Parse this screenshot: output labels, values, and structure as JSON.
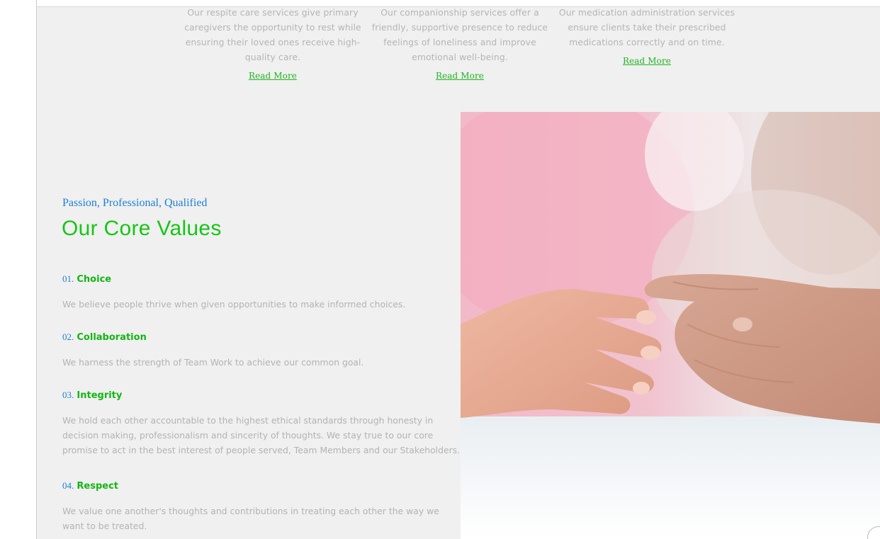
{
  "services": [
    {
      "description": "Our respite care services give primary caregivers the opportunity to rest while ensuring their loved ones receive high-quality care.",
      "lines": [
        "Our respite care services give primary",
        "caregivers the opportunity to rest while",
        "ensuring their loved ones receive high-",
        "quality care."
      ],
      "link_label": "Read More"
    },
    {
      "description": "Our companionship services offer a friendly, supportive presence to reduce feelings of loneliness and improve emotional well-being.",
      "lines": [
        "Our companionship services offer a",
        "friendly, supportive presence to reduce",
        "feelings of loneliness and improve",
        "emotional well-being."
      ],
      "link_label": "Read More"
    },
    {
      "description": "Our medication administration services ensure clients take their prescribed medications correctly and on time.",
      "lines": [
        "Our medication administration services",
        "ensure clients take their prescribed",
        "medications correctly and on time."
      ],
      "link_label": "Read More"
    }
  ],
  "core_values": {
    "eyebrow": "Passion, Professional, Qualified",
    "heading": "Our Core Values",
    "items": [
      {
        "number": "01.",
        "title": "Choice",
        "description": "We believe people thrive when given opportunities to make informed choices."
      },
      {
        "number": "02.",
        "title": "Collaboration",
        "description": "We harness the strength of Team Work to achieve our common goal."
      },
      {
        "number": "03.",
        "title": "Integrity",
        "description": "We hold each other accountable to the highest ethical standards through honesty in decision making, professionalism and sincerity of thoughts. We stay true to our core promise to act in the best interest of people served, Team Members and our Stakeholders."
      },
      {
        "number": "04.",
        "title": "Respect",
        "description": "We value one another's thoughts and contributions in treating each other the way we want to be treated."
      }
    ]
  },
  "colors": {
    "accent_green": "#16c616",
    "accent_blue": "#1d7fd6",
    "body_text": "#b3b3b3",
    "background": "#f0f0f0"
  }
}
